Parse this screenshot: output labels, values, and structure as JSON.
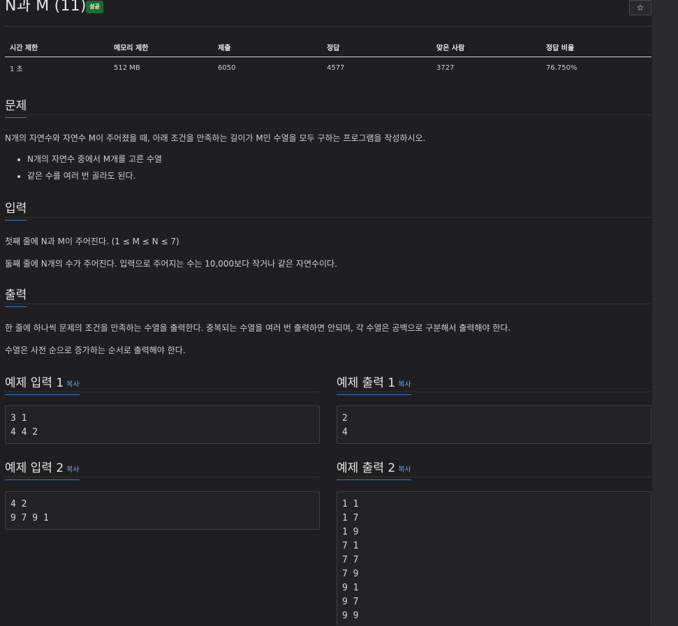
{
  "problem": {
    "title": "N과 M (11)",
    "status_badge": "성공",
    "star_icon": "☆"
  },
  "stats_table": {
    "headers": [
      "시간 제한",
      "메모리 제한",
      "제출",
      "정답",
      "맞은 사람",
      "정답 비율"
    ],
    "row": [
      "1 초",
      "512 MB",
      "6050",
      "4577",
      "3727",
      "76.750%"
    ]
  },
  "sections": {
    "problem_heading": "문제",
    "problem_text": "N개의 자연수와 자연수 M이 주어졌을 때, 아래 조건을 만족하는 길이가 M인 수열을 모두 구하는 프로그램을 작성하시오.",
    "conditions": [
      "N개의 자연수 중에서 M개를 고른 수열",
      "같은 수를 여러 번 골라도 된다."
    ],
    "input_heading": "입력",
    "input_line1": "첫째 줄에 N과 M이 주어진다. (1 ≤ M ≤ N ≤ 7)",
    "input_line2": "둘째 줄에 N개의 수가 주어진다. 입력으로 주어지는 수는 10,000보다 작거나 같은 자연수이다.",
    "output_heading": "출력",
    "output_line1": "한 줄에 하나씩 문제의 조건을 만족하는 수열을 출력한다. 중복되는 수열을 여러 번 출력하면 안되며, 각 수열은 공백으로 구분해서 출력해야 한다.",
    "output_line2": "수열은 사전 순으로 증가하는 순서로 출력해야 한다."
  },
  "samples": {
    "copy_label": "복사",
    "input1_heading": "예제 입력 1",
    "input1": "3 1\n4 4 2",
    "output1_heading": "예제 출력 1",
    "output1": "2\n4",
    "input2_heading": "예제 입력 2",
    "input2": "4 2\n9 7 9 1",
    "output2_heading": "예제 출력 2",
    "output2": "1 1\n1 7\n1 9\n7 1\n7 7\n7 9\n9 1\n9 7\n9 9"
  }
}
